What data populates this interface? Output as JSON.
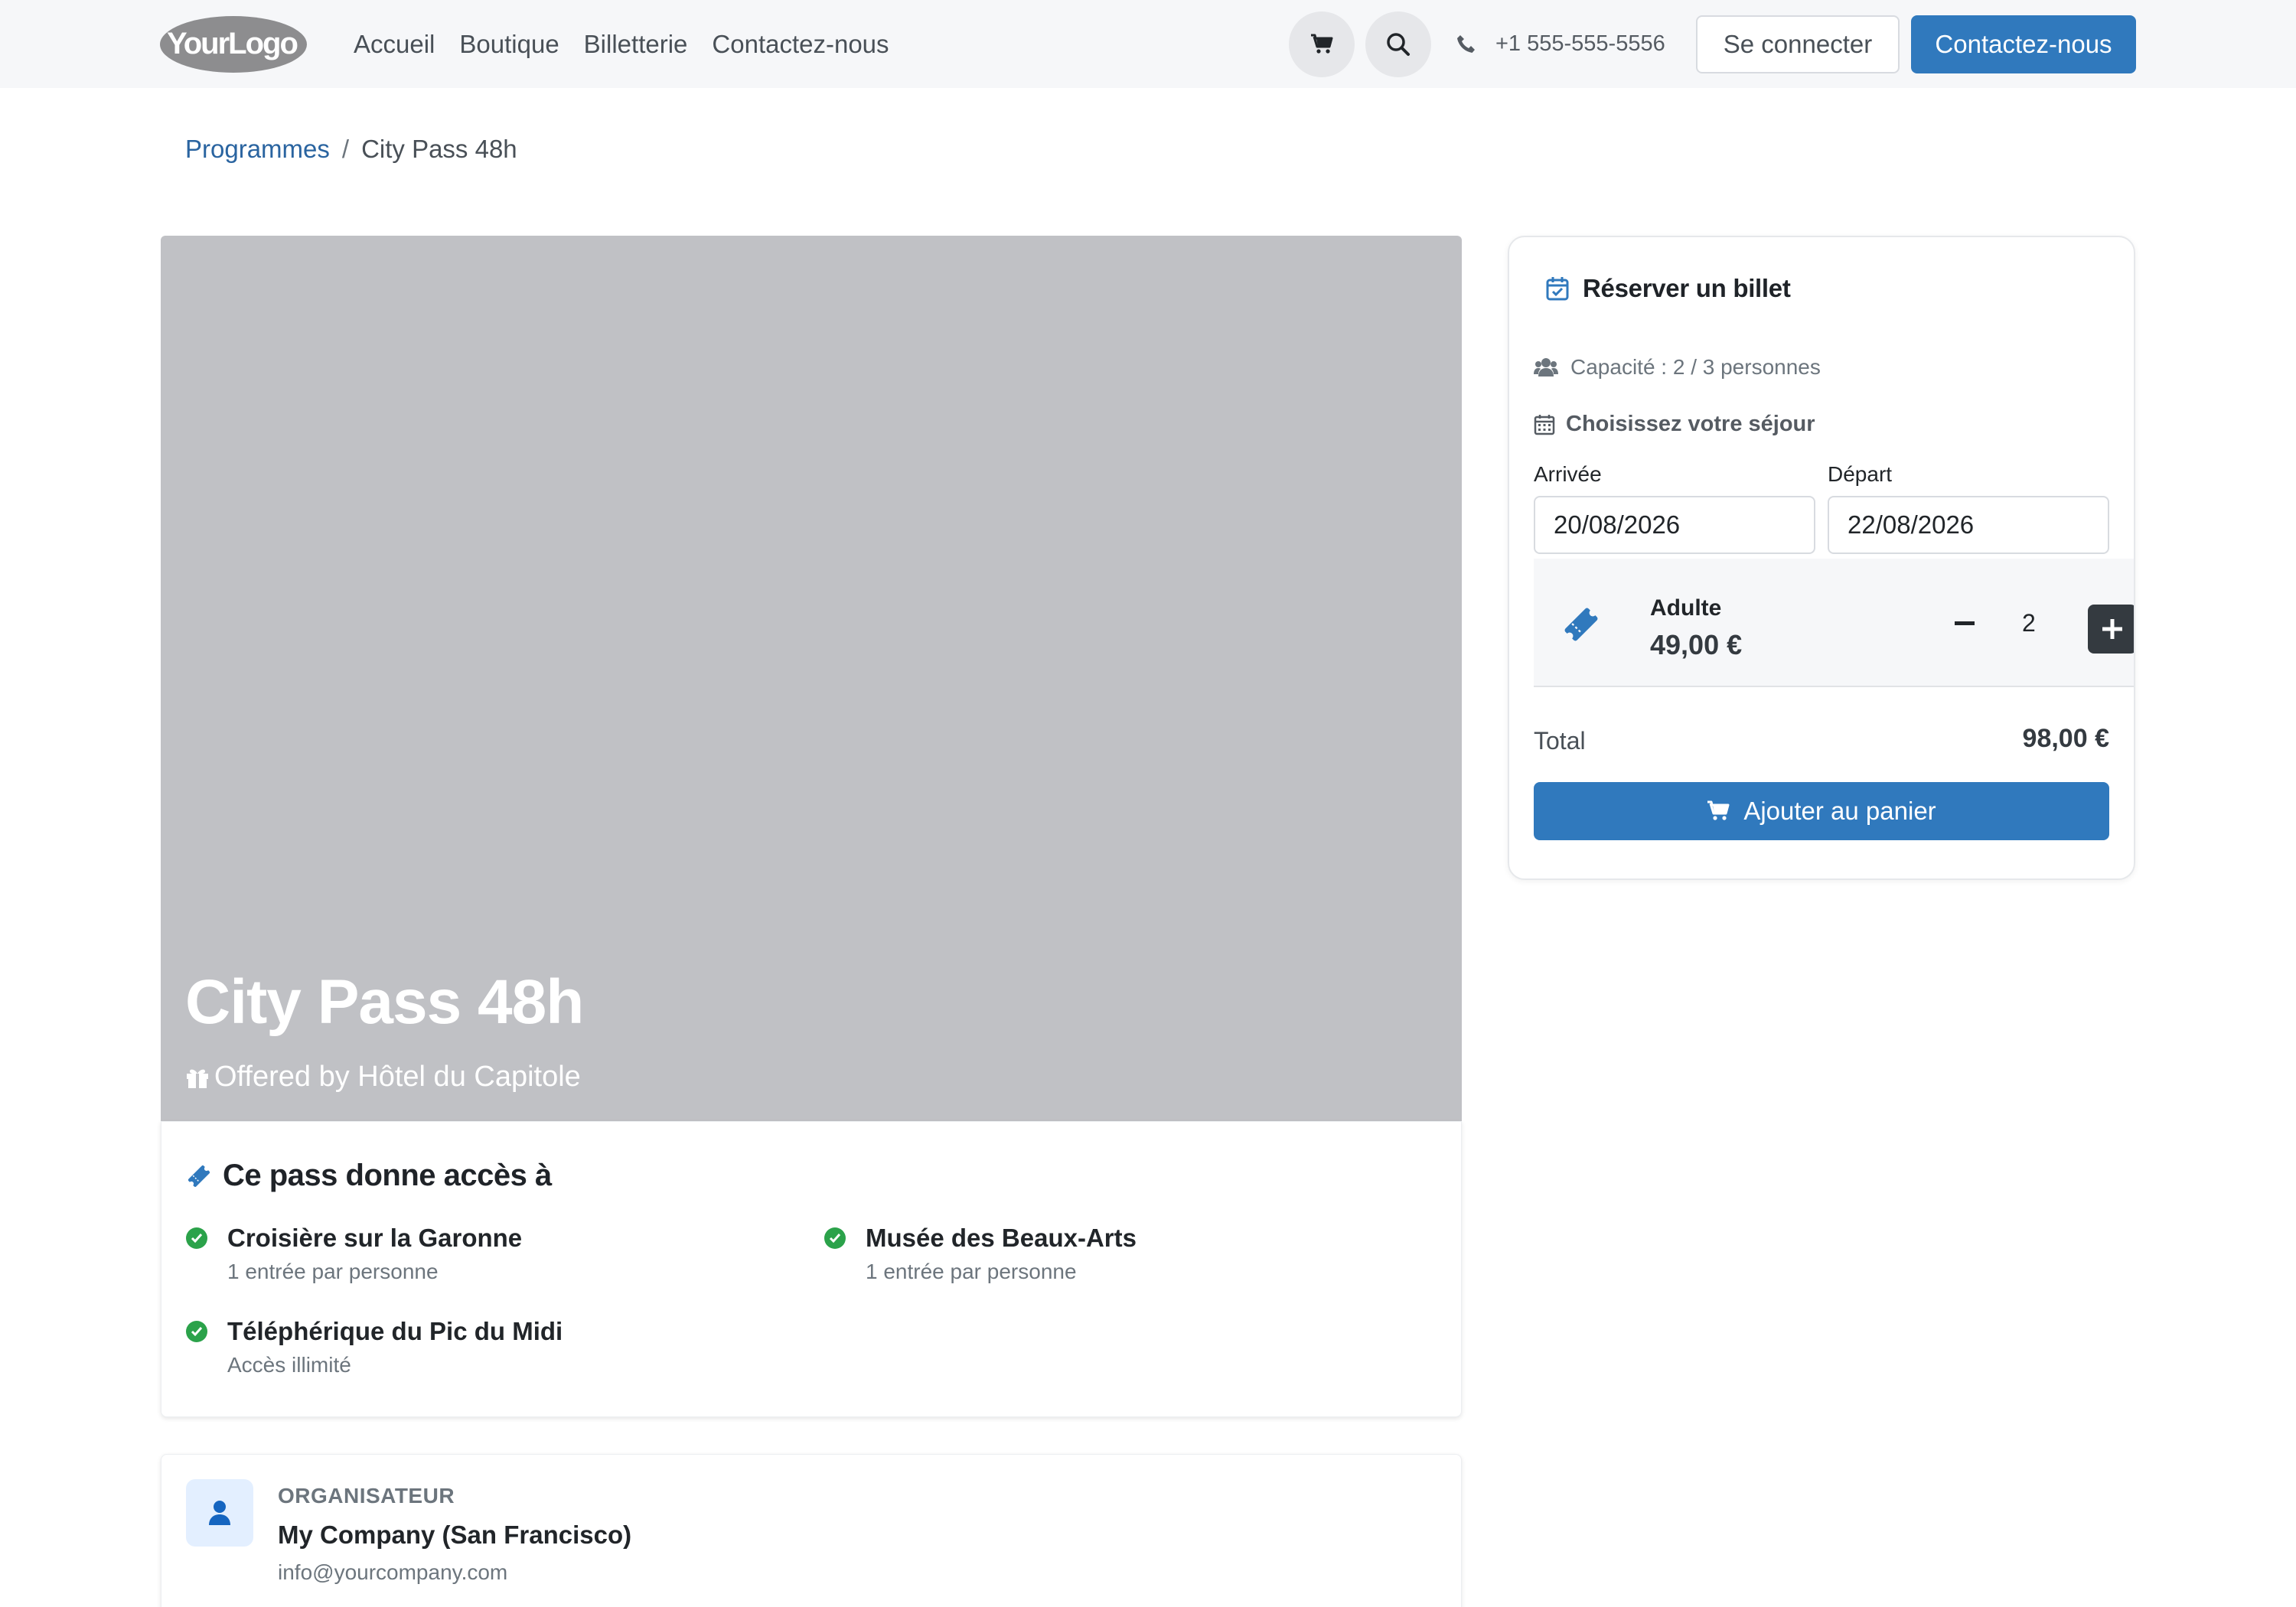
{
  "header": {
    "logo_text": "YourLogo",
    "nav": [
      "Accueil",
      "Boutique",
      "Billetterie",
      "Contactez-nous"
    ],
    "phone": "+1 555-555-5556",
    "login_label": "Se connecter",
    "contact_label": "Contactez-nous"
  },
  "breadcrumb": {
    "parent": "Programmes",
    "separator": "/",
    "current": "City Pass 48h"
  },
  "hero": {
    "title": "City Pass 48h",
    "subtitle": "Offered by Hôtel du Capitole",
    "placeholder_color": "#c0c1c5"
  },
  "access": {
    "title": "Ce pass donne accès à",
    "items": [
      {
        "name": "Croisière sur la Garonne",
        "note": "1 entrée par personne"
      },
      {
        "name": "Musée des Beaux-Arts",
        "note": "1 entrée par personne"
      },
      {
        "name": "Téléphérique du Pic du Midi",
        "note": "Accès illimité"
      }
    ]
  },
  "organizer": {
    "label": "ORGANISATEUR",
    "name": "My Company (San Francisco)",
    "email": "info@yourcompany.com"
  },
  "booking": {
    "title": "Réserver un billet",
    "capacity": "Capacité : 2 / 3 personnes",
    "stay_label": "Choisissez votre séjour",
    "arrival_label": "Arrivée",
    "arrival_value": "20/08/2026",
    "departure_label": "Départ",
    "departure_value": "22/08/2026",
    "ticket": {
      "name": "Adulte",
      "price": "49,00 €",
      "quantity": "2"
    },
    "total_label": "Total",
    "total_value": "98,00 €",
    "cart_label": "Ajouter au panier"
  },
  "colors": {
    "primary": "#3079bd",
    "success": "#2ba24a",
    "dark": "#343a40",
    "link": "#2a64a0"
  },
  "icons": [
    "cart-icon",
    "search-icon",
    "phone-icon",
    "gift-icon",
    "ticket-icon",
    "check-circle-icon",
    "user-icon",
    "calendar-check-icon",
    "users-icon",
    "calendar-icon",
    "minus-icon",
    "plus-icon"
  ]
}
